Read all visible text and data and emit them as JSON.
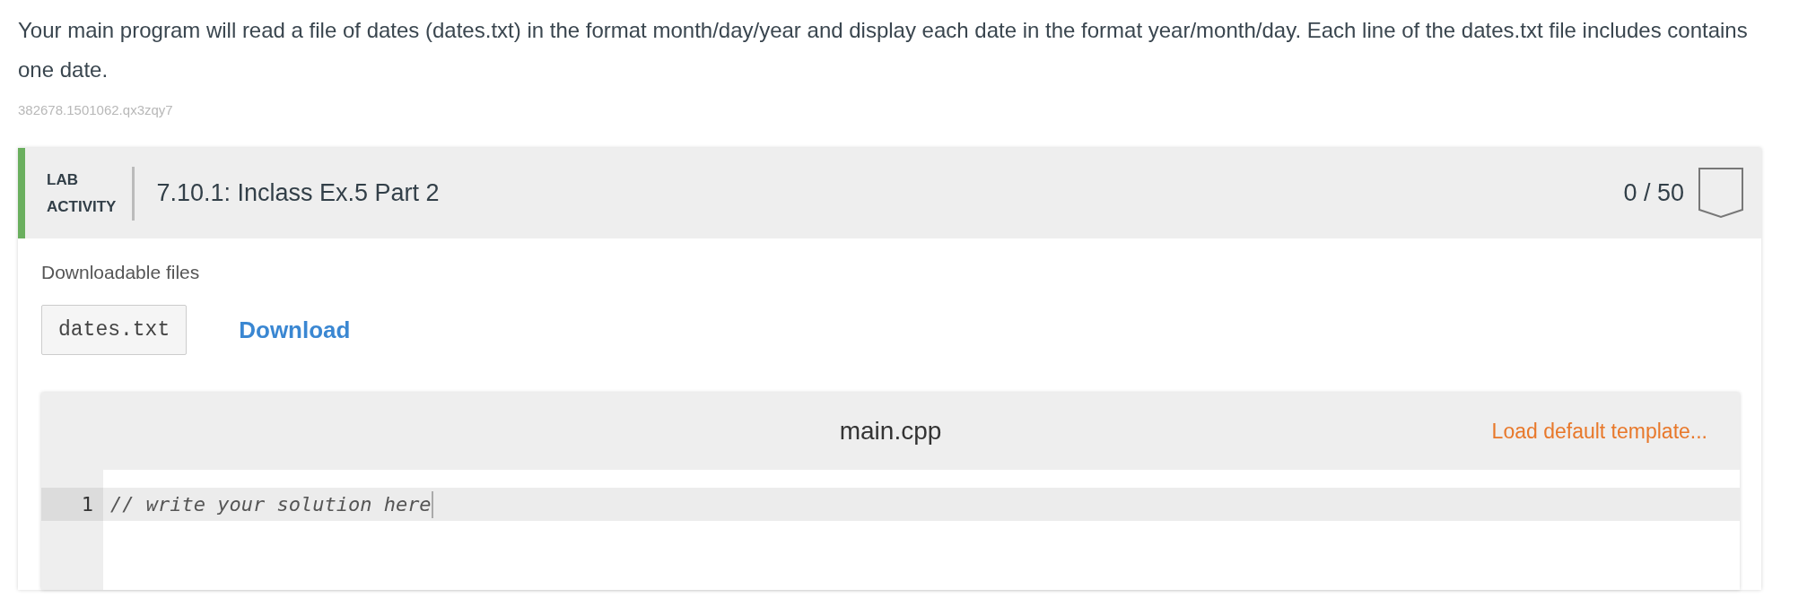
{
  "description": "Your main program will read a file of dates (dates.txt) in the format month/day/year and display each date in the format year/month/day. Each line of the dates.txt file includes contains one date.",
  "question_id": "382678.1501062.qx3zqy7",
  "activity": {
    "type_line_1": "LAB",
    "type_line_2": "ACTIVITY",
    "title": "7.10.1: Inclass Ex.5 Part 2",
    "score": "0 / 50",
    "completed": false
  },
  "downloads": {
    "heading": "Downloadable files",
    "files": [
      {
        "name": "dates.txt",
        "action": "Download"
      }
    ]
  },
  "editor": {
    "filename": "main.cpp",
    "template_link": "Load default template...",
    "lines": [
      {
        "number": "1",
        "code": "// write your solution here",
        "selected": true
      }
    ]
  }
}
